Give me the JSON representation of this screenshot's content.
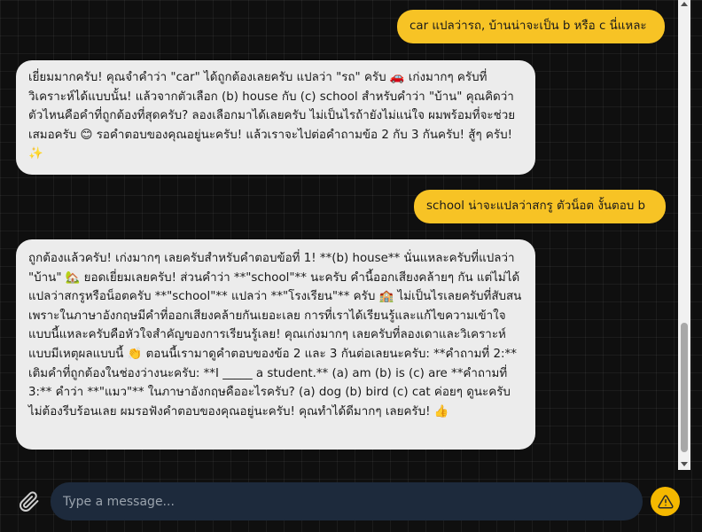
{
  "messages": [
    {
      "role": "user",
      "text": "car แปลว่ารถ, บ้านน่าจะเป็น b หรือ c นี่แหละ"
    },
    {
      "role": "assistant",
      "text": "เยี่ยมมากครับ! คุณจำคำว่า \"car\" ได้ถูกต้องเลยครับ แปลว่า \"รถ\" ครับ 🚗 เก่งมากๆ ครับที่วิเคราะห์ได้แบบนั้น! แล้วจากตัวเลือก (b) house กับ (c) school สำหรับคำว่า \"บ้าน\" คุณคิดว่าตัวไหนคือคำที่ถูกต้องที่สุดครับ? ลองเลือกมาได้เลยครับ ไม่เป็นไรถ้ายังไม่แน่ใจ ผมพร้อมที่จะช่วยเสมอครับ 😊 รอคำตอบของคุณอยู่นะครับ! แล้วเราจะไปต่อคำถามข้อ 2 กับ 3 กันครับ! สู้ๆ ครับ! ✨"
    },
    {
      "role": "user",
      "text": "school น่าจะแปลว่าสกรู ตัวน็อต งั้นตอบ b"
    },
    {
      "role": "assistant",
      "text": "ถูกต้องแล้วครับ! เก่งมากๆ เลยครับสำหรับคำตอบข้อที่ 1! **(b) house** นั่นแหละครับที่แปลว่า \"บ้าน\" 🏡 ยอดเยี่ยมเลยครับ! ส่วนคำว่า **\"school\"** นะครับ คำนี้ออกเสียงคล้ายๆ กัน แต่ไม่ได้แปลว่าสกรูหรือน็อตครับ **\"school\"** แปลว่า **\"โรงเรียน\"** ครับ 🏫 ไม่เป็นไรเลยครับที่สับสน เพราะในภาษาอังกฤษมีคำที่ออกเสียงคล้ายกันเยอะเลย การที่เราได้เรียนรู้และแก้ไขความเข้าใจแบบนี้แหละครับคือหัวใจสำคัญของการเรียนรู้เลย! คุณเก่งมากๆ เลยครับที่ลองเดาและวิเคราะห์แบบมีเหตุผลแบบนี้ 👏 ตอนนี้เรามาดูคำตอบของข้อ 2 และ 3 กันต่อเลยนะครับ: **คำถามที่ 2:** เติมคำที่ถูกต้องในช่องว่างนะครับ: **I _____ a student.** (a) am (b) is (c) are **คำถามที่ 3:** คำว่า **\"แมว\"** ในภาษาอังกฤษคืออะไรครับ? (a) dog (b) bird (c) cat ค่อยๆ ดูนะครับ ไม่ต้องรีบร้อนเลย ผมรอฟังคำตอบของคุณอยู่นะครับ! คุณทำได้ดีมากๆ เลยครับ! 👍"
    }
  ],
  "composer": {
    "placeholder": "Type a message..."
  },
  "icons": {
    "attach": "paperclip-icon",
    "send": "warning-triangle-icon"
  },
  "colors": {
    "user_bubble": "#f7c325",
    "assistant_bubble": "#ececec",
    "input_bg": "#1d2a3c",
    "send_button": "#f5b800"
  }
}
